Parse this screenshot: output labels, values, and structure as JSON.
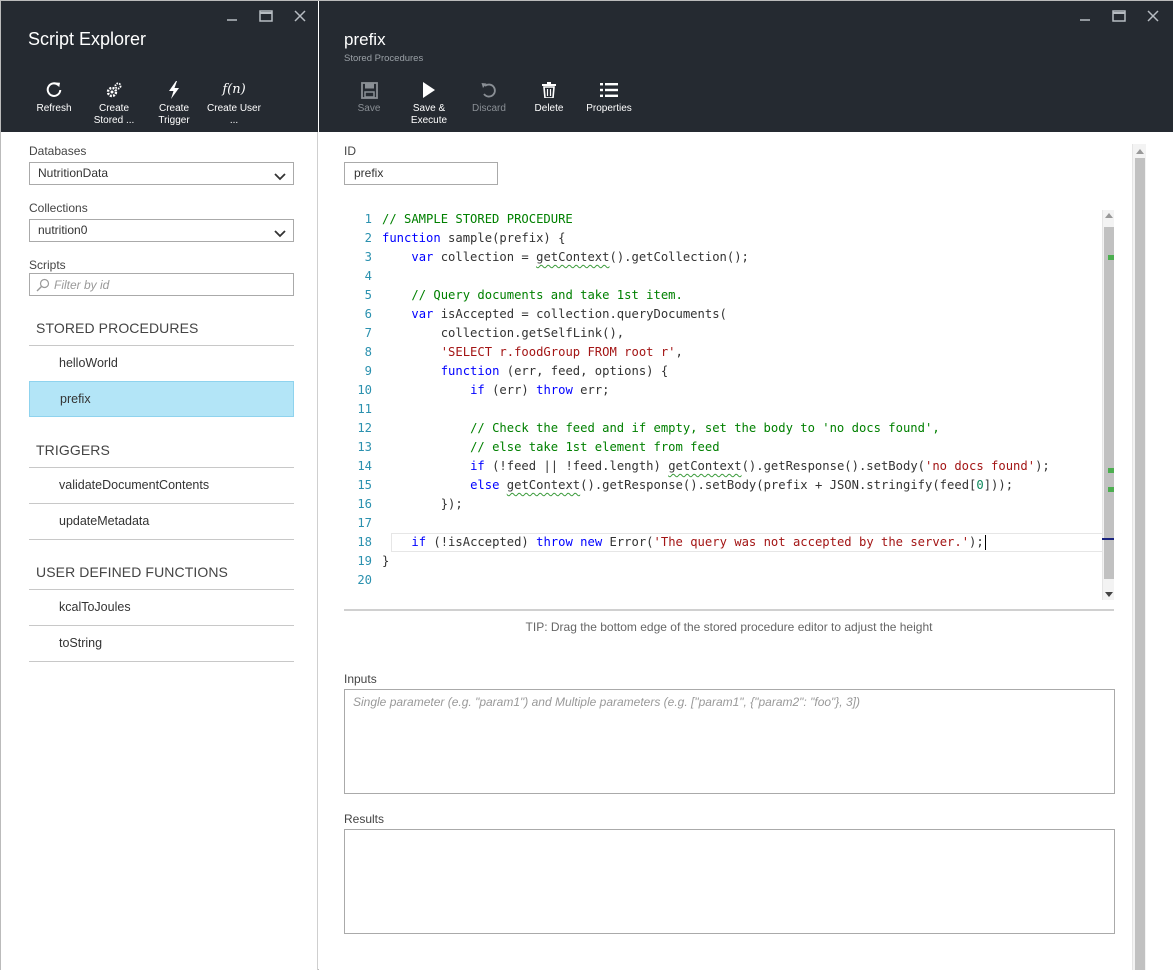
{
  "left_blade": {
    "title": "Script Explorer",
    "commands": [
      {
        "icon": "refresh-icon",
        "label": "Refresh"
      },
      {
        "icon": "gears-icon",
        "label": "Create Stored ..."
      },
      {
        "icon": "lightning-icon",
        "label": "Create Trigger"
      },
      {
        "icon": "function-icon",
        "label": "Create User ..."
      }
    ],
    "databases_label": "Databases",
    "database_selected": "NutritionData",
    "collections_label": "Collections",
    "collection_selected": "nutrition0",
    "scripts_label": "Scripts",
    "filter_placeholder": "Filter by id",
    "sections": [
      {
        "title": "STORED PROCEDURES",
        "items": [
          "helloWorld",
          "prefix"
        ]
      },
      {
        "title": "TRIGGERS",
        "items": [
          "validateDocumentContents",
          "updateMetadata"
        ]
      },
      {
        "title": "USER DEFINED FUNCTIONS",
        "items": [
          "kcalToJoules",
          "toString"
        ]
      }
    ],
    "selected_item": "prefix"
  },
  "right_blade": {
    "title": "prefix",
    "subtitle": "Stored Procedures",
    "commands": [
      {
        "icon": "save-icon",
        "label": "Save",
        "enabled": false
      },
      {
        "icon": "play-icon",
        "label": "Save & Execute",
        "enabled": true
      },
      {
        "icon": "undo-icon",
        "label": "Discard",
        "enabled": false
      },
      {
        "icon": "trash-icon",
        "label": "Delete",
        "enabled": true
      },
      {
        "icon": "list-icon",
        "label": "Properties",
        "enabled": true
      }
    ],
    "id_label": "ID",
    "id_value": "prefix",
    "code_line_numbers": [
      "1",
      "2",
      "3",
      "4",
      "5",
      "6",
      "7",
      "8",
      "9",
      "10",
      "11",
      "12",
      "13",
      "14",
      "15",
      "16",
      "17",
      "18",
      "19",
      "20"
    ],
    "tip": "TIP: Drag the bottom edge of the stored procedure editor to adjust the height",
    "inputs_label": "Inputs",
    "inputs_placeholder": "Single parameter (e.g. \"param1\") and Multiple parameters (e.g. [\"param1\", {\"param2\": \"foo\"}, 3])",
    "results_label": "Results"
  }
}
